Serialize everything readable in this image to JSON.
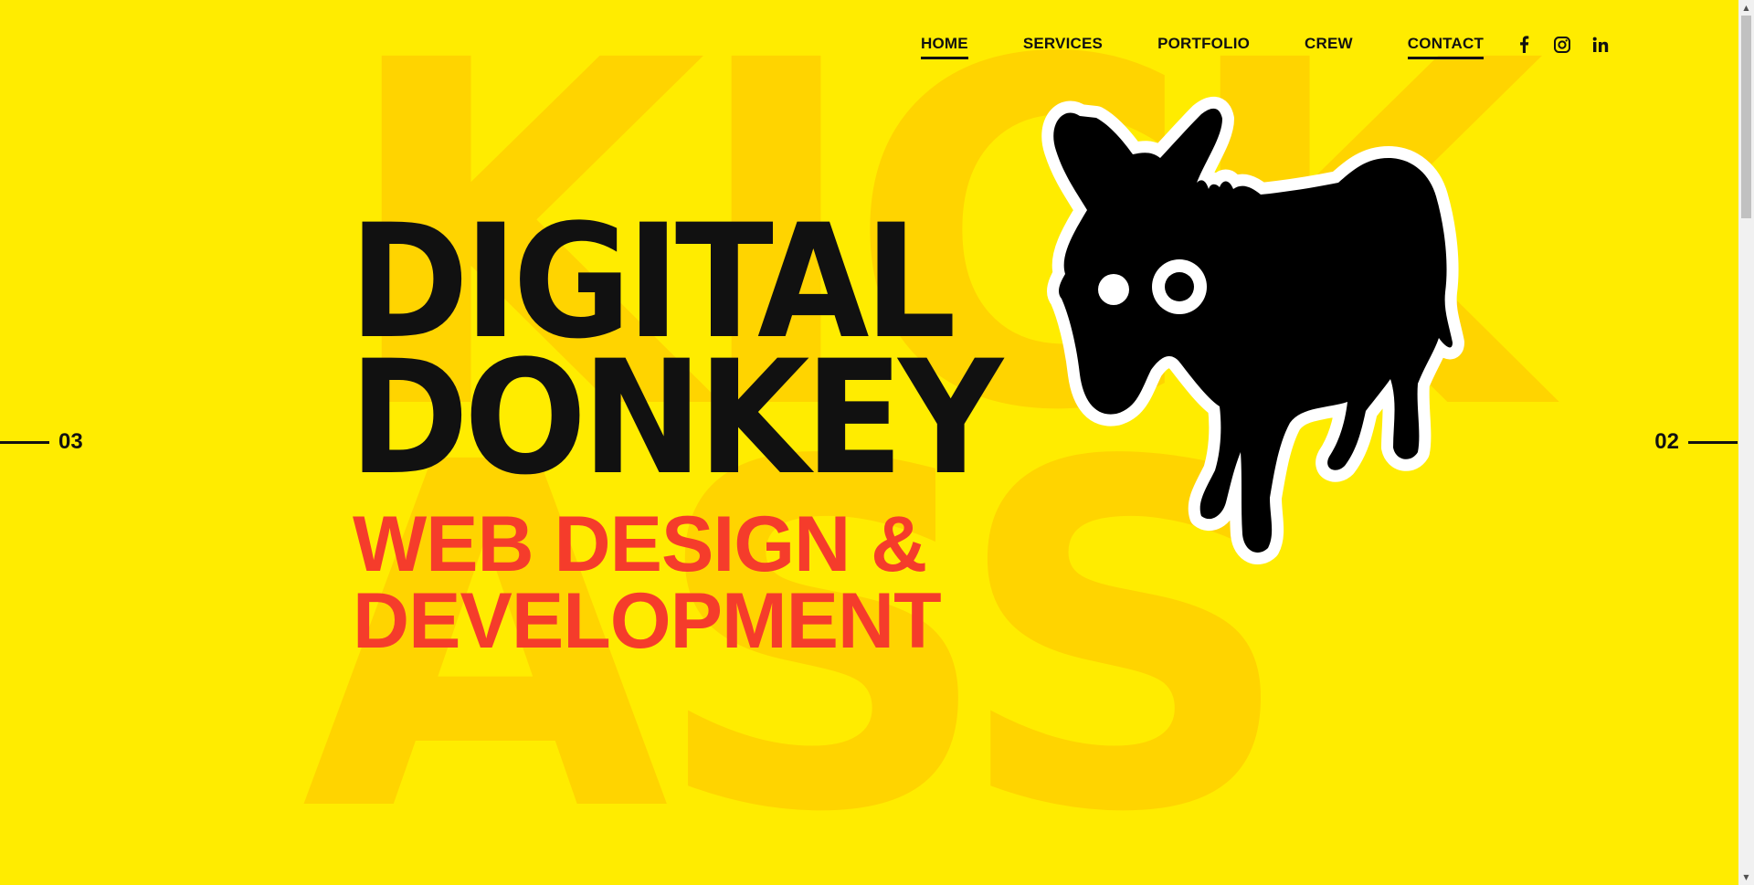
{
  "background_watermark": {
    "top_word": "KICK",
    "bottom_word": "ASS"
  },
  "nav": {
    "items": [
      {
        "label": "HOME",
        "active": true
      },
      {
        "label": "SERVICES",
        "active": false
      },
      {
        "label": "PORTFOLIO",
        "active": false
      },
      {
        "label": "CREW",
        "active": false
      },
      {
        "label": "CONTACT",
        "active": true
      }
    ],
    "social": [
      "facebook-icon",
      "instagram-icon",
      "linkedin-icon"
    ]
  },
  "hero": {
    "title_line1": "DIGITAL",
    "title_line2": "DONKEY",
    "subtitle_line1": "WEB DESIGN &",
    "subtitle_line2": "DEVELOPMENT"
  },
  "slider": {
    "prev": "03",
    "next": "02"
  },
  "colors": {
    "background": "#ffec00",
    "watermark": "#ffd400",
    "title": "#111111",
    "subtitle": "#f53c2b"
  }
}
